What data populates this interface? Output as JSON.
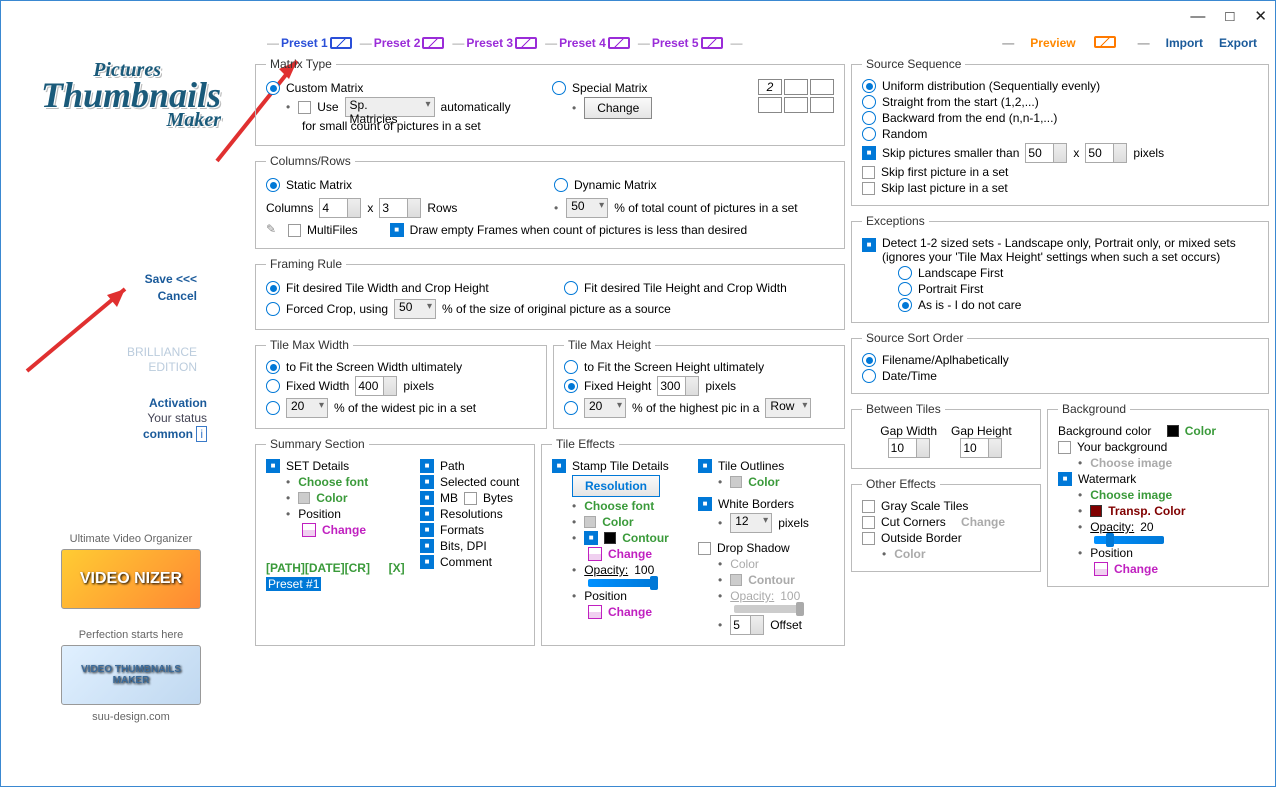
{
  "titlebar": {
    "min": "—",
    "max": "□",
    "close": "✕"
  },
  "logo": {
    "l1": "Pictures",
    "l2": "Thumbnails",
    "l3": "Maker"
  },
  "sidebar": {
    "save": "Save <<<",
    "cancel": "Cancel",
    "brilliance": "BRILLIANCE",
    "edition": "EDITION",
    "activation": "Activation",
    "your_status": "Your status",
    "common": "common",
    "info_icon": "i",
    "ad1_title": "Ultimate Video Organizer",
    "ad1_txt": "VIDEO NIZER",
    "ad2_title": "Perfection starts here",
    "ad2_txt": "VIDEO THUMBNAILS MAKER",
    "site": "suu-design.com"
  },
  "presets": [
    "Preset 1",
    "Preset 2",
    "Preset 3",
    "Preset 4",
    "Preset 5"
  ],
  "rightlinks": {
    "preview": "Preview",
    "import": "Import",
    "export": "Export"
  },
  "matrix": {
    "legend": "Matrix Type",
    "custom": "Custom Matrix",
    "use": "Use",
    "dd": "Sp. Matricies",
    "auto": "automatically",
    "sub": "for small count of pictures in a set",
    "special": "Special Matrix",
    "change": "Change",
    "gridnum": "2"
  },
  "colrows": {
    "legend": "Columns/Rows",
    "static": "Static Matrix",
    "dynamic": "Dynamic Matrix",
    "columns": "Columns",
    "cols_v": "4",
    "x": "x",
    "rows_v": "3",
    "rows": "Rows",
    "pct": "50",
    "pct_txt": "% of total count of pictures in a set",
    "multi": "MultiFiles",
    "draw": "Draw empty Frames when count of pictures is less than desired"
  },
  "framing": {
    "legend": "Framing Rule",
    "fit_w": "Fit desired Tile Width and Crop Height",
    "fit_h": "Fit desired Tile Height and Crop Width",
    "forced": "Forced Crop, using",
    "pct": "50",
    "txt": "% of the size of original picture as a source"
  },
  "tmw": {
    "legend": "Tile Max Width",
    "fit": "to Fit the Screen Width ultimately",
    "fixed": "Fixed Width",
    "val": "400",
    "px": "pixels",
    "pct": "20",
    "pct_txt": "% of the widest pic in a set"
  },
  "tmh": {
    "legend": "Tile Max Height",
    "fit": "to Fit the Screen Height ultimately",
    "fixed": "Fixed Height",
    "val": "300",
    "px": "pixels",
    "pct": "20",
    "pct_txt": "% of the highest pic in a",
    "row": "Row"
  },
  "summary": {
    "legend": "Summary Section",
    "set": "SET Details",
    "choose": "Choose font",
    "color": "Color",
    "position": "Position",
    "change": "Change",
    "path": "Path",
    "selcount": "Selected count",
    "mb": "MB",
    "bytes": "Bytes",
    "res": "Resolutions",
    "formats": "Formats",
    "bits": "Bits, DPI",
    "comment": "Comment",
    "macro": "[PATH][DATE][CR]",
    "x": "[X]",
    "preset": "Preset #1"
  },
  "tile": {
    "legend": "Tile Effects",
    "stamp": "Stamp Tile Details",
    "resolution": "Resolution",
    "choose": "Choose font",
    "color": "Color",
    "contour": "Contour",
    "change": "Change",
    "op_lbl": "Opacity:",
    "op_v": "100",
    "position": "Position",
    "outlines": "Tile Outlines",
    "whitebd": "White Borders",
    "wb_v": "12",
    "px": "pixels",
    "drop": "Drop Shadow",
    "cont2": "Contour",
    "op2": "100",
    "off_v": "5",
    "offset": "Offset"
  },
  "source": {
    "legend": "Source Sequence",
    "uniform": "Uniform distribution (Sequentially evenly)",
    "start": "Straight from the start (1,2,...)",
    "end": "Backward from the end (n,n-1,...)",
    "random": "Random",
    "skip_small": "Skip pictures smaller than",
    "w": "50",
    "x": "x",
    "h": "50",
    "px": "pixels",
    "skip_first": "Skip first picture in a set",
    "skip_last": "Skip last picture in a set"
  },
  "exc": {
    "legend": "Exceptions",
    "detect": "Detect 1-2 sized sets - Landscape only, Portrait only, or mixed sets (ignores your 'Tile Max Height' settings when such a set occurs)",
    "land": "Landscape First",
    "port": "Portrait First",
    "asis": "As is - I do not care"
  },
  "sort": {
    "legend": "Source Sort Order",
    "file": "Filename/Aplhabetically",
    "date": "Date/Time"
  },
  "between": {
    "legend": "Between Tiles",
    "gw": "Gap Width",
    "gh": "Gap Height",
    "v": "10"
  },
  "other": {
    "legend": "Other Effects",
    "gray": "Gray Scale Tiles",
    "cut": "Cut Corners",
    "change": "Change",
    "outside": "Outside Border",
    "color": "Color"
  },
  "bg": {
    "legend": "Background",
    "bgcolor": "Background color",
    "color": "Color",
    "your": "Your background",
    "choose": "Choose image",
    "wm": "Watermark",
    "transp": "Transp. Color",
    "op_lbl": "Opacity:",
    "op_v": "20",
    "position": "Position",
    "change": "Change"
  }
}
